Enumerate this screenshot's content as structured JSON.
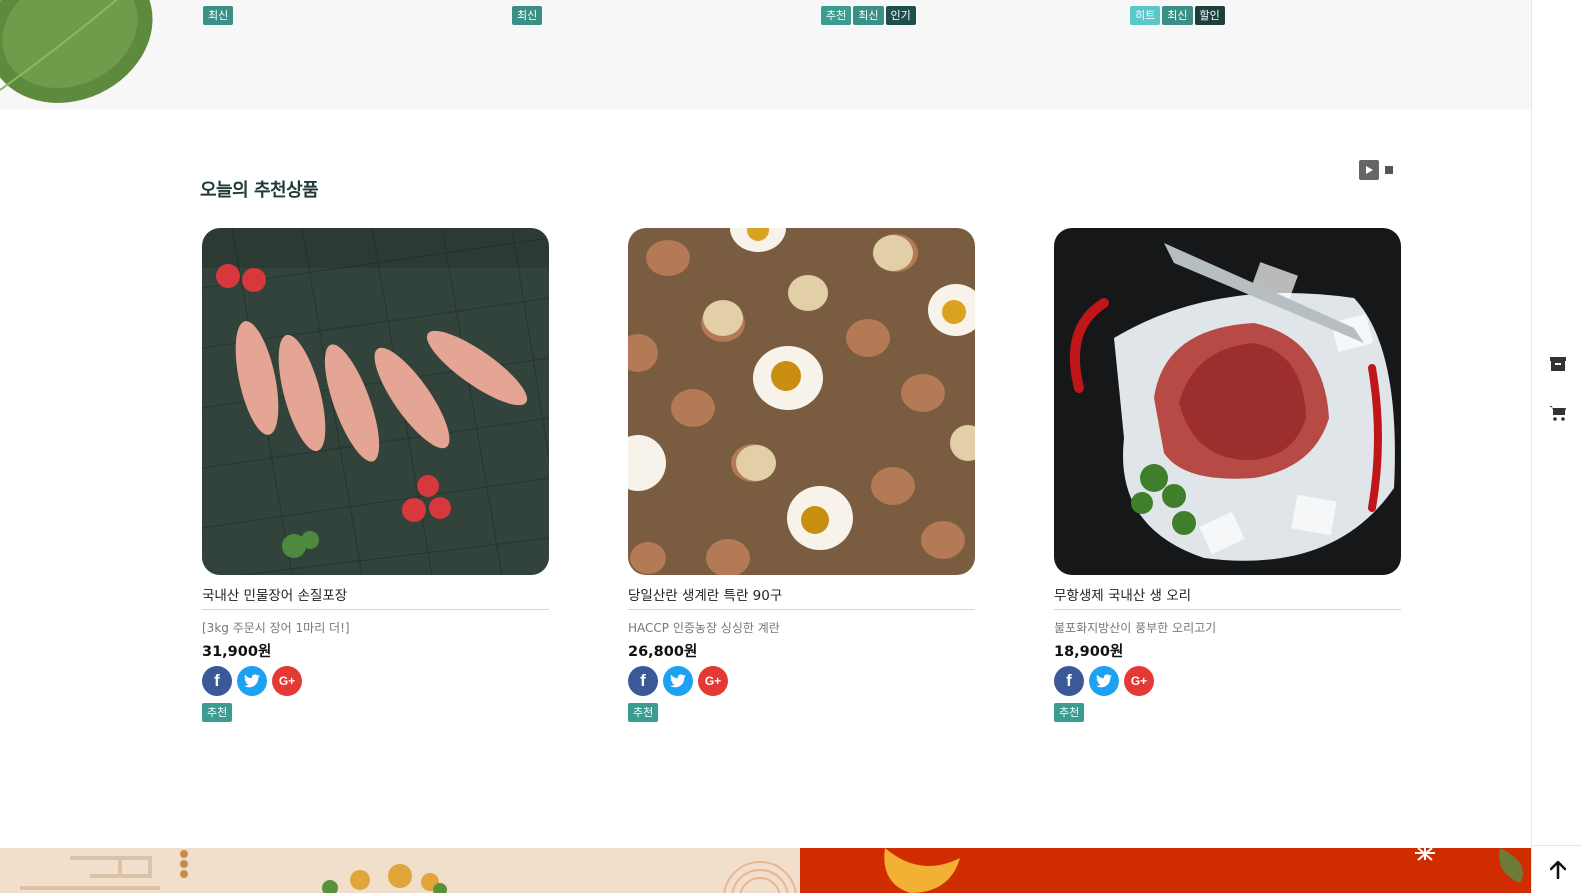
{
  "top_badges": [
    [
      "최신"
    ],
    [
      "최신"
    ],
    [
      "추천",
      "최신",
      "인기"
    ],
    [
      "히트",
      "최신",
      "할인"
    ]
  ],
  "section": {
    "title": "오늘의 추천상품"
  },
  "products": [
    {
      "name": "국내산 민물장어 손질포장",
      "desc": "[3kg 주문시 장어 1마리 더!]",
      "price": "31,900원",
      "badge": "추천",
      "image": "fish-photo"
    },
    {
      "name": "당일산란 생계란 특란 90구",
      "desc": "HACCP 인증농장 싱싱한 계란",
      "price": "26,800원",
      "badge": "추천",
      "image": "eggs-photo"
    },
    {
      "name": "무항생제 국내산 생 오리",
      "desc": "불포화지방산이 풍부한 오리고기",
      "price": "18,900원",
      "badge": "추천",
      "image": "meat-photo"
    }
  ],
  "sns": {
    "facebook": "f",
    "twitter": "twitter-bird-icon",
    "google": "G+"
  },
  "right_rail": {
    "icons": [
      "archive-box-icon",
      "cart-icon",
      "arrow-up-icon"
    ]
  },
  "colors": {
    "accent": "#3a8f86",
    "title": "#1e3b3a",
    "banner_red": "#cf2d00",
    "banner_beige": "#f1dfcc"
  }
}
